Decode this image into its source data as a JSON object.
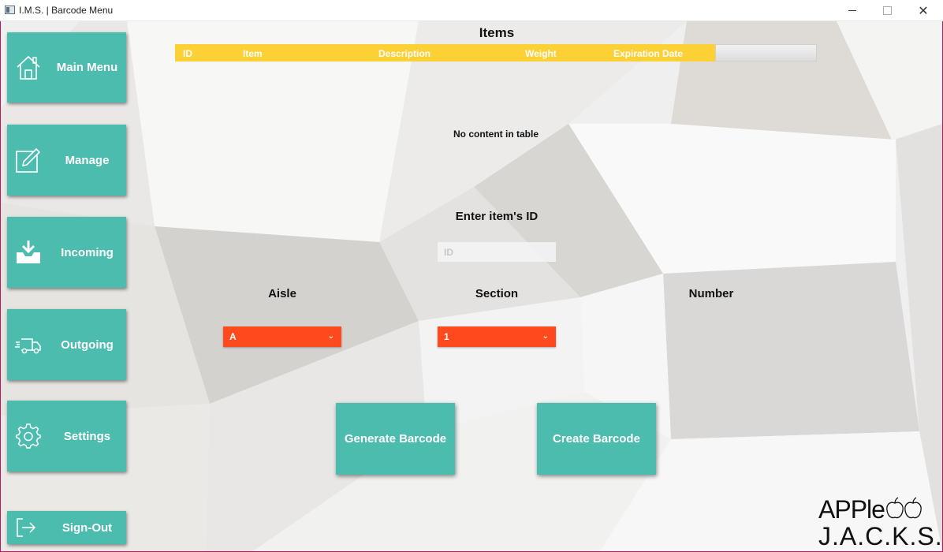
{
  "window": {
    "title": "I.M.S. | Barcode Menu",
    "controls": [
      "minimize",
      "maximize",
      "close"
    ]
  },
  "sidebar": {
    "items": [
      {
        "label": "Main Menu",
        "icon": "home-icon"
      },
      {
        "label": "Manage",
        "icon": "edit-icon"
      },
      {
        "label": "Incoming",
        "icon": "inbox-download-icon"
      },
      {
        "label": "Outgoing",
        "icon": "delivery-truck-icon"
      },
      {
        "label": "Settings",
        "icon": "gear-icon"
      },
      {
        "label": "Sign-Out",
        "icon": "sign-out-icon"
      }
    ]
  },
  "items_table": {
    "title": "Items",
    "columns": [
      "ID",
      "Item",
      "Description",
      "Weight",
      "Expiration Date"
    ],
    "rows": [],
    "empty_text": "No content in table",
    "header_color": "#fdd035"
  },
  "id_entry": {
    "label": "Enter item's ID",
    "placeholder": "ID",
    "value": ""
  },
  "location": {
    "aisle": {
      "label": "Aisle",
      "selected": "A"
    },
    "section": {
      "label": "Section",
      "selected": "1"
    },
    "number": {
      "label": "Number"
    }
  },
  "actions": {
    "generate": "Generate Barcode",
    "create": "Create Barcode"
  },
  "logo": {
    "line1": "APPle",
    "line2": "J.A.C.K.S."
  },
  "colors": {
    "accent_teal": "#4bbcad",
    "dropdown_orange": "#fe4a1d",
    "table_header_yellow": "#fdd035"
  }
}
